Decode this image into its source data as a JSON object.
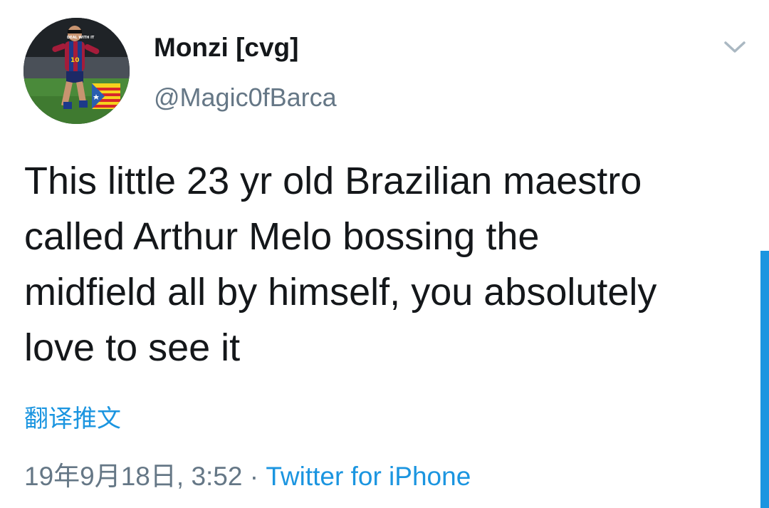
{
  "tweet": {
    "author": {
      "display_name": "Monzi [cvg]",
      "handle": "@Magic0fBarca",
      "avatar_caption": "DEAL WITH IT"
    },
    "text_lines": [
      "This little 23 yr old Brazilian maestro",
      "called Arthur Melo bossing the",
      "midfield all by himself, you absolutely",
      "love to see it"
    ],
    "translate_label": "翻译推文",
    "timestamp": "19年9月18日, 3:52",
    "separator": "·",
    "source": "Twitter for iPhone"
  },
  "icons": {
    "menu": "chevron-down-icon"
  },
  "colors": {
    "text": "#14171a",
    "secondary": "#657786",
    "link": "#1b95e0"
  }
}
